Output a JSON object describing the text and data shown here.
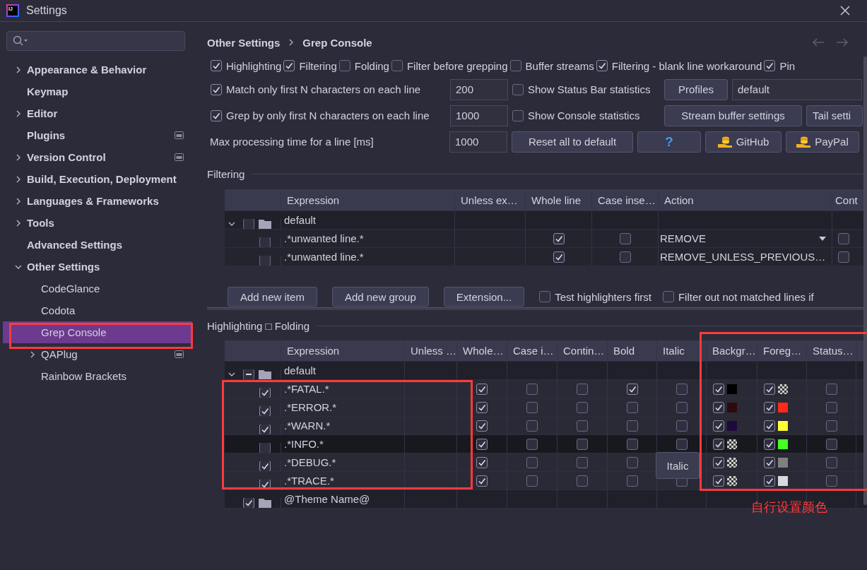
{
  "window": {
    "title": "Settings",
    "logo": "IJ"
  },
  "sidebar": {
    "items": [
      {
        "label": "Appearance & Behavior",
        "kind": "group",
        "expanded": false,
        "selected": false
      },
      {
        "label": "Keymap",
        "kind": "page",
        "selected": false
      },
      {
        "label": "Editor",
        "kind": "group",
        "expanded": false,
        "selected": false
      },
      {
        "label": "Plugins",
        "kind": "page",
        "selected": false,
        "managed": true
      },
      {
        "label": "Version Control",
        "kind": "group",
        "expanded": false,
        "selected": false,
        "managed": true
      },
      {
        "label": "Build, Execution, Deployment",
        "kind": "group",
        "expanded": false,
        "selected": false
      },
      {
        "label": "Languages & Frameworks",
        "kind": "group",
        "expanded": false,
        "selected": false
      },
      {
        "label": "Tools",
        "kind": "group",
        "expanded": false,
        "selected": false
      },
      {
        "label": "Advanced Settings",
        "kind": "page",
        "selected": false
      },
      {
        "label": "Other Settings",
        "kind": "group",
        "expanded": true,
        "selected": false,
        "children": [
          {
            "label": "CodeGlance",
            "kind": "page",
            "selected": false
          },
          {
            "label": "Codota",
            "kind": "page",
            "selected": false
          },
          {
            "label": "Grep Console",
            "kind": "page",
            "selected": true
          },
          {
            "label": "QAPlug",
            "kind": "group",
            "expanded": false,
            "selected": false,
            "managed": true
          },
          {
            "label": "Rainbow Brackets",
            "kind": "page",
            "selected": false
          }
        ]
      }
    ]
  },
  "breadcrumb": [
    "Other Settings",
    "Grep Console"
  ],
  "options": {
    "flags": [
      {
        "label": "Highlighting",
        "checked": true
      },
      {
        "label": "Filtering",
        "checked": true
      },
      {
        "label": "Folding",
        "checked": false
      },
      {
        "label": "Filter before grepping",
        "checked": false
      },
      {
        "label": "Buffer streams",
        "checked": false
      },
      {
        "label": "Filtering - blank line workaround",
        "checked": true
      },
      {
        "label": "Pin",
        "checked": true
      }
    ],
    "rows": [
      {
        "items": [
          {
            "kind": "checkbox",
            "label": "Match only first N characters on each line",
            "checked": true
          },
          {
            "kind": "input",
            "value": "200"
          },
          {
            "kind": "checkbox",
            "label": "Show Status Bar statistics",
            "checked": false
          },
          {
            "kind": "button",
            "label": "Profiles"
          },
          {
            "kind": "dropdown",
            "value": "default"
          }
        ]
      },
      {
        "items": [
          {
            "kind": "checkbox",
            "label": "Grep by only first N characters on each line",
            "checked": true
          },
          {
            "kind": "input",
            "value": "1000"
          },
          {
            "kind": "checkbox",
            "label": "Show Console statistics",
            "checked": false
          },
          {
            "kind": "button",
            "label": "Stream buffer settings"
          },
          {
            "kind": "button",
            "label": "Tail setti"
          }
        ]
      },
      {
        "items": [
          {
            "kind": "label",
            "label": "Max processing time for a line [ms]"
          },
          {
            "kind": "input",
            "value": "1000"
          },
          {
            "kind": "button",
            "label": "Reset all to default"
          },
          {
            "kind": "help",
            "label": "?"
          },
          {
            "kind": "donate",
            "label": "GitHub"
          },
          {
            "kind": "donate",
            "label": "PayPal"
          }
        ]
      }
    ]
  },
  "filtering": {
    "title": "Filtering",
    "columns": [
      "Expression",
      "Unless ex…",
      "Whole line",
      "Case inse…",
      "Action",
      "Cont"
    ],
    "groups": [
      {
        "label": "default",
        "expanded": true,
        "checked": false,
        "children": [
          {
            "enabled": false,
            "expression": ".*unwanted line.*",
            "whole_line": true,
            "case_insensitive": false,
            "action": "REMOVE",
            "continue": false
          },
          {
            "enabled": false,
            "expression": ".*unwanted line.*",
            "whole_line": true,
            "case_insensitive": false,
            "action": "REMOVE_UNLESS_PREVIOUS…",
            "continue": false
          }
        ]
      }
    ],
    "buttons": [
      "Add new item",
      "Add new group",
      "Extension..."
    ],
    "options": [
      {
        "label": "Test highlighters first",
        "checked": false
      },
      {
        "label": "Filter out not matched lines if",
        "checked": false
      }
    ]
  },
  "highlighting": {
    "title": "Highlighting □ Folding",
    "columns": [
      "Expression",
      "Unless …",
      "Whole…",
      "Case i…",
      "Contin…",
      "Bold",
      "Italic",
      "Backgr…",
      "Foreg…",
      "Status…"
    ],
    "groups": [
      {
        "label": "default",
        "expanded": true,
        "mixed": true,
        "children": [
          {
            "enabled": true,
            "expression": ".*FATAL.*",
            "whole_line": true,
            "case_insensitive": false,
            "continue": false,
            "bold": true,
            "italic": false,
            "background": {
              "checked": true,
              "color": "#000000"
            },
            "foreground": {
              "checked": true
            },
            "status": false,
            "hovered": false
          },
          {
            "enabled": true,
            "expression": ".*ERROR.*",
            "whole_line": true,
            "case_insensitive": false,
            "continue": false,
            "bold": false,
            "italic": false,
            "background": {
              "checked": true,
              "color": "#2e0a10"
            },
            "foreground": {
              "checked": true,
              "color": "#ff2a1a"
            },
            "status": false,
            "hovered": false
          },
          {
            "enabled": true,
            "expression": ".*WARN.*",
            "whole_line": true,
            "case_insensitive": false,
            "continue": false,
            "bold": false,
            "italic": false,
            "background": {
              "checked": true,
              "color": "#1e0a3a"
            },
            "foreground": {
              "checked": true,
              "color": "#ffff33"
            },
            "status": false,
            "hovered": false
          },
          {
            "enabled": false,
            "expression": ".*INFO.*",
            "whole_line": true,
            "case_insensitive": false,
            "continue": false,
            "bold": false,
            "italic": false,
            "background": {
              "checked": true
            },
            "foreground": {
              "checked": true,
              "color": "#44ff22"
            },
            "status": false,
            "hovered": true
          },
          {
            "enabled": true,
            "expression": ".*DEBUG.*",
            "whole_line": true,
            "case_insensitive": false,
            "continue": false,
            "bold": false,
            "background": {
              "checked": true
            },
            "foreground": {
              "checked": true,
              "color": "#808080"
            },
            "status": false,
            "hovered": false
          },
          {
            "enabled": true,
            "expression": ".*TRACE.*",
            "whole_line": true,
            "case_insensitive": false,
            "continue": false,
            "bold": false,
            "italic": false,
            "background": {
              "checked": true
            },
            "foreground": {
              "checked": true,
              "color": "#d8d8e0"
            },
            "status": false,
            "hovered": false
          }
        ]
      },
      {
        "label": "@Theme Name@",
        "checked": true
      }
    ],
    "tooltip": "Italic"
  },
  "annotation": {
    "note": "自行设置颜色",
    "color": "#ff3b3b"
  }
}
